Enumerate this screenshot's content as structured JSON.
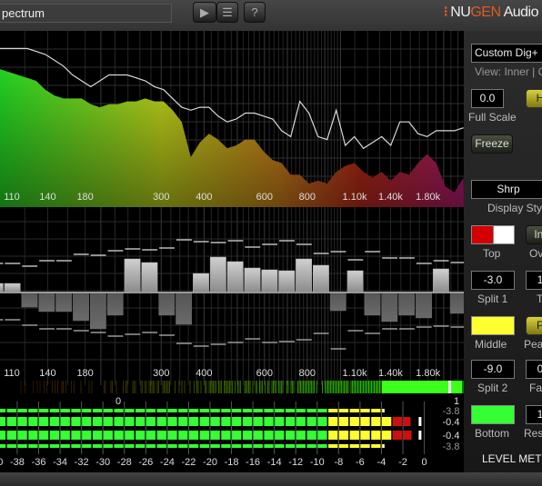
{
  "titlebar": {
    "title": "pectrum",
    "play_icon": "play-icon",
    "menu_icon": "list-icon",
    "help_label": "?",
    "logo": {
      "dots": "⁝",
      "nu": "NU",
      "gen": "GEN",
      "audio": " Audio"
    }
  },
  "spectrum": {
    "x_scale": "log",
    "freq_range_hz": [
      101.5,
      2285
    ],
    "level_unit": "dB",
    "freq_labels": [
      "110",
      "140",
      "180",
      "300",
      "400",
      "600",
      "800",
      "1.10k",
      "1.40k",
      "1.80k"
    ],
    "freq_label_values": [
      110,
      140,
      180,
      300,
      400,
      600,
      800,
      1100,
      1400,
      1800
    ],
    "fill_level_db": [
      -13,
      -14,
      -15,
      -16,
      -17,
      -20,
      -22,
      -23,
      -23,
      -23,
      -25,
      -26,
      -25,
      -25,
      -24,
      -24,
      -23,
      -24,
      -24,
      -27,
      -31,
      -43,
      -38,
      -35,
      -37,
      -40,
      -39,
      -37,
      -37,
      -41,
      -44,
      -45,
      -49,
      -49,
      -52,
      -51,
      -52,
      -48,
      -46,
      -45,
      -48,
      -50,
      -48,
      -51,
      -48,
      -49,
      -45,
      -42,
      -45,
      -53,
      -55,
      -50
    ],
    "peak_line_db": [
      -6,
      -6,
      -6,
      -6,
      -7,
      -8,
      -10,
      -12,
      -15,
      -17,
      -19,
      -17,
      -15,
      -15,
      -15,
      -16,
      -17,
      -19,
      -20,
      -23,
      -26,
      -27,
      -26,
      -26,
      -29,
      -31,
      -30,
      -28,
      -28,
      -29,
      -30,
      -34,
      -36,
      -24,
      -28,
      -36,
      -37,
      -27,
      -39,
      -36,
      -40,
      -38,
      -36,
      -39,
      -31,
      -31,
      -35,
      -36,
      -34,
      -34,
      -34,
      -33
    ],
    "colors": [
      "#22cc22",
      "#b8c81a",
      "#c07a1a",
      "#b82020",
      "#b0206a"
    ]
  },
  "deviation": {
    "bands_db": [
      1.0,
      1.0,
      -1.6,
      -2.1,
      -2.1,
      -3.1,
      -4.0,
      -2.5,
      3.7,
      3.3,
      -2.5,
      -3.5,
      2.1,
      3.9,
      3.4,
      2.7,
      2.5,
      2.4,
      3.7,
      3.0,
      -2.0,
      2.4,
      -2.5,
      -3.2,
      -2.5,
      -2.8,
      2.6,
      -2.3
    ],
    "upper_hold_db": [
      3.2,
      3.2,
      2.9,
      3.5,
      3.5,
      4.2,
      4.1,
      4.6,
      4.8,
      4.7,
      4.9,
      5.8,
      5.6,
      5.5,
      5.7,
      5.0,
      5.3,
      5.7,
      5.3,
      4.3,
      4.5,
      3.6,
      4.5,
      3.8,
      3.8,
      3.2,
      3.5,
      3.3
    ],
    "lower_hold_db": [
      -3.0,
      -3.0,
      -3.6,
      -4.0,
      -4.0,
      -4.2,
      -4.4,
      -4.8,
      -4.6,
      -4.4,
      -4.7,
      -5.6,
      -5.9,
      -5.7,
      -5.5,
      -5.1,
      -5.5,
      -5.4,
      -5.2,
      -4.5,
      -6.2,
      -4.2,
      -4.5,
      -4.0,
      -4.0,
      -3.8,
      -3.7,
      -3.8
    ]
  },
  "correlation": {
    "value": 0.98,
    "min_label": "0",
    "max_label": "1",
    "range": [
      0,
      1
    ]
  },
  "level_meter": {
    "range_db": [
      -40,
      0
    ],
    "scale_labels": [
      "-40",
      "-38",
      "-36",
      "-34",
      "-32",
      "-30",
      "-28",
      "-26",
      "-24",
      "-22",
      "-20",
      "-18",
      "-16",
      "-14",
      "-12",
      "-10",
      "-8",
      "-6",
      "-4",
      "-2",
      "0"
    ],
    "split1_db": -3.0,
    "split2_db": -9.0,
    "channels": [
      {
        "rms_db": -3.8,
        "rms_label": "-3.8",
        "peak_db": -1.2,
        "hold_db": -0.4,
        "hold_label": "-0.4"
      },
      {
        "rms_db": -3.8,
        "rms_label": "-3.8",
        "peak_db": -1.1,
        "hold_db": -0.4,
        "hold_label": "-0.4"
      }
    ],
    "colors": {
      "top": "#cc1010",
      "middle": "#ffff30",
      "bottom": "#33ff33"
    }
  },
  "panel": {
    "preset": "Custom Dig+",
    "view_text": "View: Inner | C",
    "full_scale_value": "0.0",
    "full_scale_label": "Full Scale",
    "h_button": "H",
    "freeze_button": "Freeze",
    "display_style_value": "Shrp",
    "display_style_label": "Display Sty",
    "top_label": "Top",
    "int_button": "Int",
    "over_label": "Ov",
    "split1_value": "-3.0",
    "split1_label": "Split 1",
    "t_box": "1",
    "t_label": "T",
    "middle_label": "Middle",
    "p_button": "P",
    "peak_label": "Pea",
    "split2_value": "-9.0",
    "split2_label": "Split 2",
    "fall_box": "0",
    "fall_label": "Fal",
    "bottom_label": "Bottom",
    "res_box": "1",
    "res_label": "Res",
    "section_title": "LEVEL MET",
    "top_colors": [
      "#d40000",
      "#ffffff"
    ],
    "middle_color": "#ffff30",
    "bottom_color": "#33ff33"
  }
}
